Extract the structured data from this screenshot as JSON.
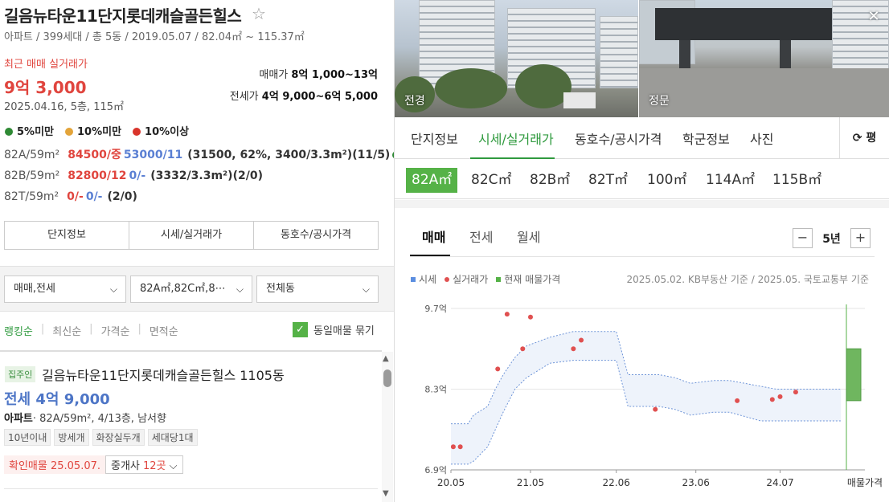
{
  "header": {
    "title": "길음뉴타운11단지롯데캐슬골든힐스",
    "subinfo": "아파트 / 399세대 / 총 5동 / 2019.05.07 / 82.04㎡ ~ 115.37㎡"
  },
  "recent": {
    "label": "최근 매매 실거래가",
    "price": "9억 3,000",
    "date": "2025.04.16, 5층, 115㎡"
  },
  "ranges": {
    "sale_label": "매매가",
    "sale_value": "8억 1,000~13억",
    "jeonse_label": "전세가",
    "jeonse_value": "4억 9,000~6억 5,000"
  },
  "legend": [
    {
      "label": "5%미만",
      "color": "#2f8a35"
    },
    {
      "label": "10%미만",
      "color": "#e3a43a"
    },
    {
      "label": "10%이상",
      "color": "#d9342b"
    }
  ],
  "area_rows": [
    {
      "type": "82A/59m²",
      "sale": "84500/중",
      "jeonse": "53000/11",
      "extra": "(31500, 62%, 3400/3.3m²)(11/5)"
    },
    {
      "type": "82B/59m²",
      "sale": "82800/12",
      "jeonse": "0/-",
      "extra": "(3332/3.3m²)(2/0)"
    },
    {
      "type": "82T/59m²",
      "sale": "0/-",
      "jeonse": "0/-",
      "extra": "(2/0)"
    }
  ],
  "left_tabs": [
    "단지정보",
    "시세/실거래가",
    "동호수/공시가격"
  ],
  "filters": [
    "매매,전세",
    "82A㎡,82C㎡,8⋯",
    "전체동"
  ],
  "sort": {
    "items": [
      "랭킹순",
      "최신순",
      "가격순",
      "면적순"
    ],
    "group_label": "동일매물 묶기"
  },
  "listing": {
    "badge": "집주인",
    "title": "길음뉴타운11단지롯데캐슬골든힐스 1105동",
    "price": "전세 4억 9,000",
    "desc_strong": "아파트",
    "desc": "· 82A/59m², 4/13층, 남서향",
    "tags": [
      "10년이내",
      "방세개",
      "화장실두개",
      "세대당1대"
    ],
    "confirm": "확인매물 25.05.07.",
    "agent_prefix": "중개사 ",
    "agent_count": "12곳"
  },
  "photos": {
    "left_label": "전경",
    "right_label": "정문"
  },
  "right_tabs": [
    "단지정보",
    "시세/실거래가",
    "동호수/공시가격",
    "학군정보",
    "사진"
  ],
  "unit_toggle": "평",
  "areas": [
    "82A㎡",
    "82C㎡",
    "82B㎡",
    "82T㎡",
    "100㎡",
    "114A㎡",
    "115B㎡"
  ],
  "trade_tabs": [
    "매매",
    "전세",
    "월세"
  ],
  "period": "5년",
  "chart_legend": [
    {
      "label": "시세",
      "color": "#5b8ee0",
      "shape": "square"
    },
    {
      "label": "실거래가",
      "color": "#e05050",
      "shape": "dot"
    },
    {
      "label": "현재 매물가격",
      "color": "#55b247",
      "shape": "square"
    }
  ],
  "chart_note": "2025.05.02. KB부동산 기준 / 2025.05. 국토교통부 기준",
  "chart_data": {
    "type": "line",
    "x_ticks": [
      "20.05",
      "21.05",
      "22.06",
      "23.06",
      "24.07"
    ],
    "extra_x_label": "매물가격",
    "y_ticks": [
      "9.7억",
      "8.3억",
      "6.9억"
    ],
    "ylim": [
      6.9,
      9.7
    ],
    "xlim": [
      2020.33,
      2025.4
    ],
    "band": {
      "name": "시세",
      "x": [
        2020.33,
        2020.55,
        2020.62,
        2020.8,
        2020.9,
        2021.0,
        2021.15,
        2021.3,
        2021.6,
        2021.9,
        2022.3,
        2022.45,
        2022.6,
        2023.0,
        2023.2,
        2023.4,
        2023.7,
        2023.9,
        2024.3,
        2024.5,
        2024.8,
        2025.33
      ],
      "upper": [
        7.7,
        7.7,
        7.85,
        8.0,
        8.3,
        8.55,
        8.85,
        9.05,
        9.2,
        9.3,
        9.3,
        9.3,
        8.55,
        8.55,
        8.5,
        8.4,
        8.45,
        8.45,
        8.35,
        8.3,
        8.3,
        8.3
      ],
      "lower": [
        7.0,
        7.0,
        7.05,
        7.3,
        7.6,
        7.9,
        8.3,
        8.5,
        8.75,
        8.8,
        8.8,
        8.8,
        8.0,
        8.0,
        7.95,
        7.85,
        7.9,
        7.9,
        7.75,
        7.75,
        7.75,
        7.75
      ]
    },
    "points": {
      "name": "실거래가",
      "x": [
        2020.36,
        2020.45,
        2020.93,
        2021.05,
        2021.25,
        2021.35,
        2021.9,
        2022.0,
        2022.95,
        2024.0,
        2024.45,
        2024.55,
        2024.75
      ],
      "y": [
        7.3,
        7.3,
        8.65,
        9.6,
        9.0,
        9.55,
        9.0,
        9.15,
        7.95,
        8.1,
        8.12,
        8.17,
        8.25
      ]
    },
    "current": {
      "name": "현재 매물가격",
      "low": 8.1,
      "high": 9.0
    }
  }
}
